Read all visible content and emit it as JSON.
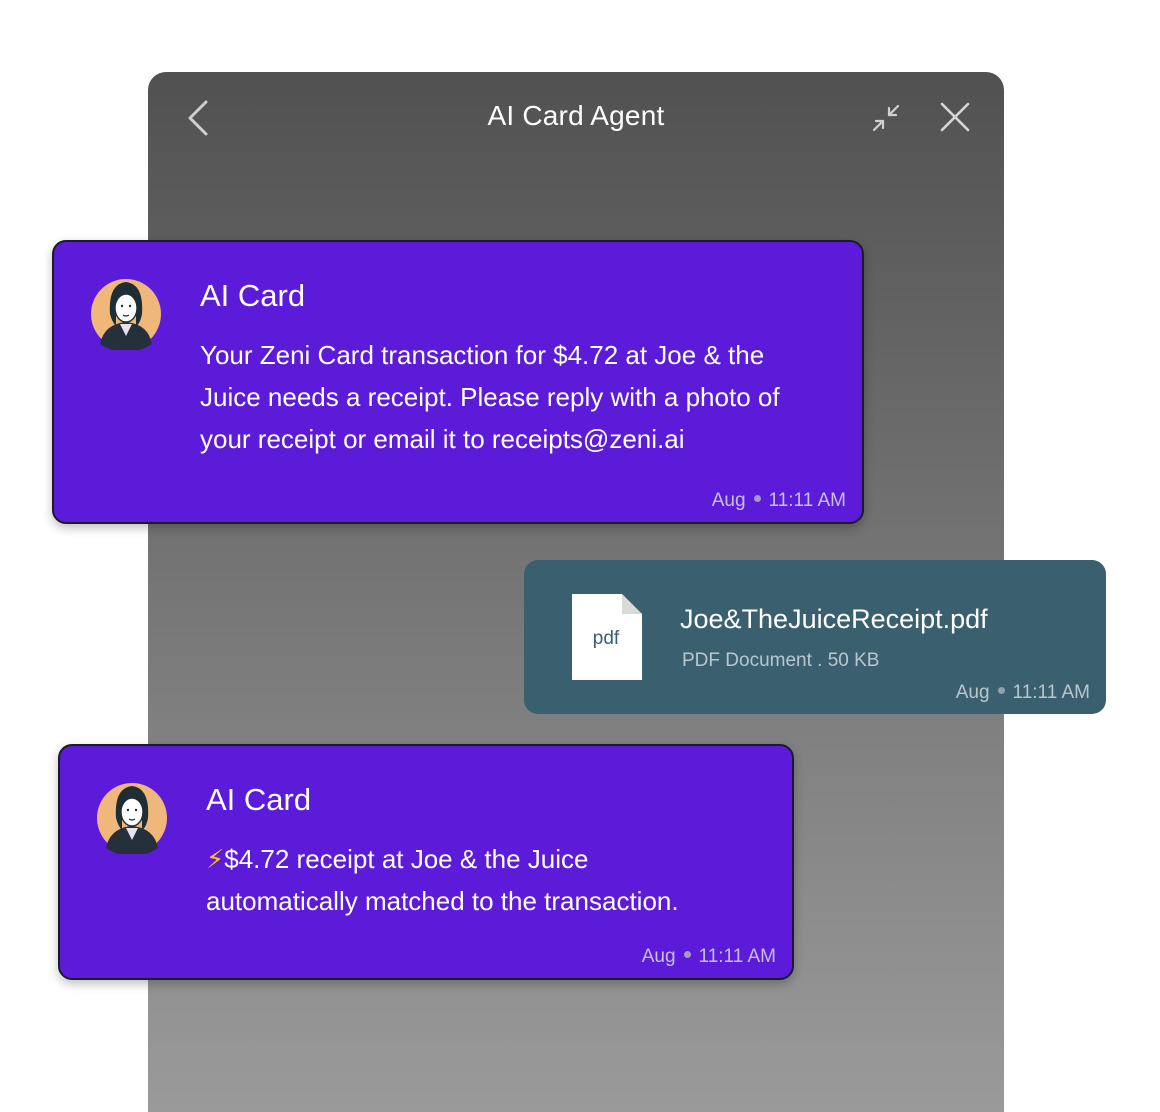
{
  "header": {
    "title": "AI Card Agent",
    "back_icon": "chevron-left-icon",
    "minimize_icon": "minimize-arrows-icon",
    "close_icon": "close-icon"
  },
  "messages": [
    {
      "sender": "AI Card",
      "text": "Your Zeni Card transaction for $4.72 at Joe & the Juice needs a receipt. Please reply with a photo of your receipt or email it to receipts@zeni.ai",
      "date": "Aug",
      "time": "11:11 AM"
    },
    {
      "file_name": "Joe&TheJuiceReceipt.pdf",
      "file_meta": "PDF Document . 50 KB",
      "file_icon_label": "pdf",
      "date": "Aug",
      "time": "11:11 AM"
    },
    {
      "sender": "AI Card",
      "bolt": "⚡",
      "text": "$4.72 receipt at Joe & the Juice automatically matched to the transaction.",
      "date": "Aug",
      "time": "11:11 AM"
    }
  ],
  "colors": {
    "ai_bubble": "#5b1bd9",
    "file_bubble": "#3a6070",
    "avatar_bg": "#f0b77a"
  }
}
